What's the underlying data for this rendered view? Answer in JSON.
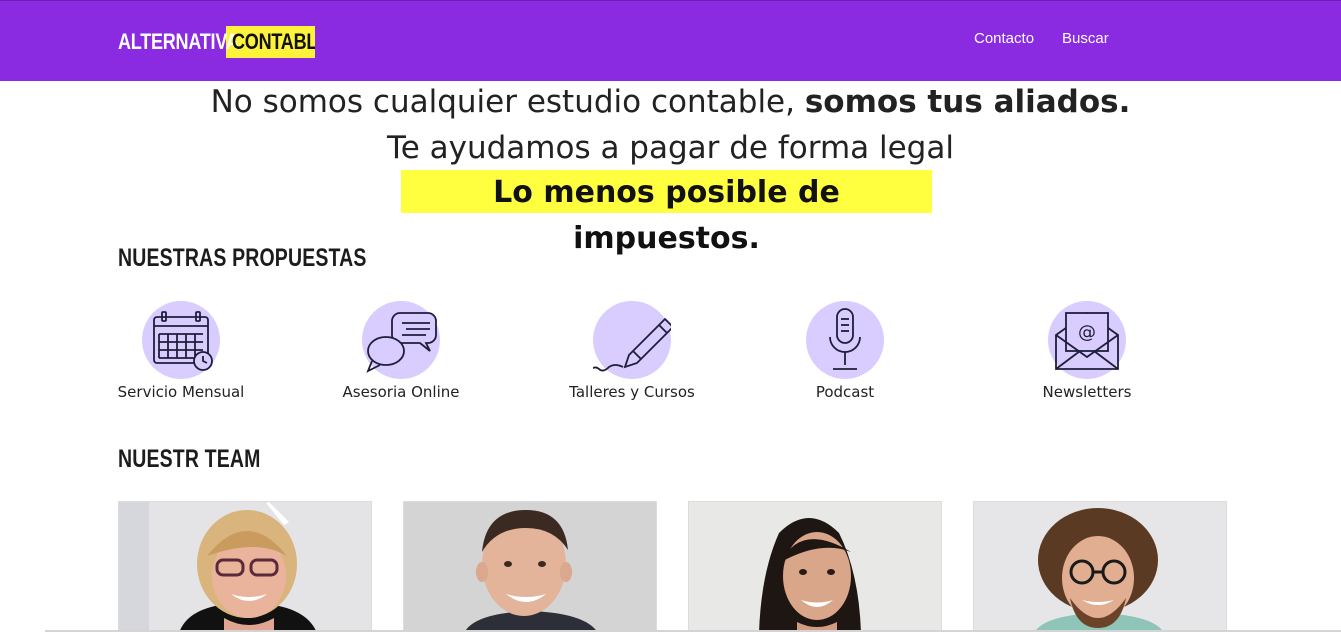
{
  "brand": {
    "part1": "ALTERNATIVA",
    "part2": "CONTABLE"
  },
  "nav": {
    "contacto": "Contacto",
    "buscar": "Buscar"
  },
  "hero": {
    "line1_regular": "No somos cualquier estudio contable, ",
    "line1_bold": "somos tus aliados.",
    "line2": "Te ayudamos a pagar de forma legal",
    "line3": "Lo menos posible de impuestos."
  },
  "proposals": {
    "title": "NUESTRAS PROPUESTAS",
    "items": [
      {
        "label": "Servicio Mensual",
        "icon": "calendar-clock-icon"
      },
      {
        "label": "Asesoria Online",
        "icon": "chat-bubbles-icon"
      },
      {
        "label": "Talleres y Cursos",
        "icon": "pencil-icon"
      },
      {
        "label": "Podcast",
        "icon": "microphone-icon"
      },
      {
        "label": "Newsletters",
        "icon": "envelope-at-icon"
      }
    ]
  },
  "team": {
    "title": "NUESTR TEAM",
    "members": [
      {
        "photo": "team-photo-woman-glasses"
      },
      {
        "photo": "team-photo-man-smiling"
      },
      {
        "photo": "team-photo-woman-dark-hair"
      },
      {
        "photo": "team-photo-man-curly-glasses"
      }
    ]
  },
  "colors": {
    "header": "#8a2be2",
    "highlight": "#ffff40",
    "icon_bg": "#d9ccff"
  }
}
